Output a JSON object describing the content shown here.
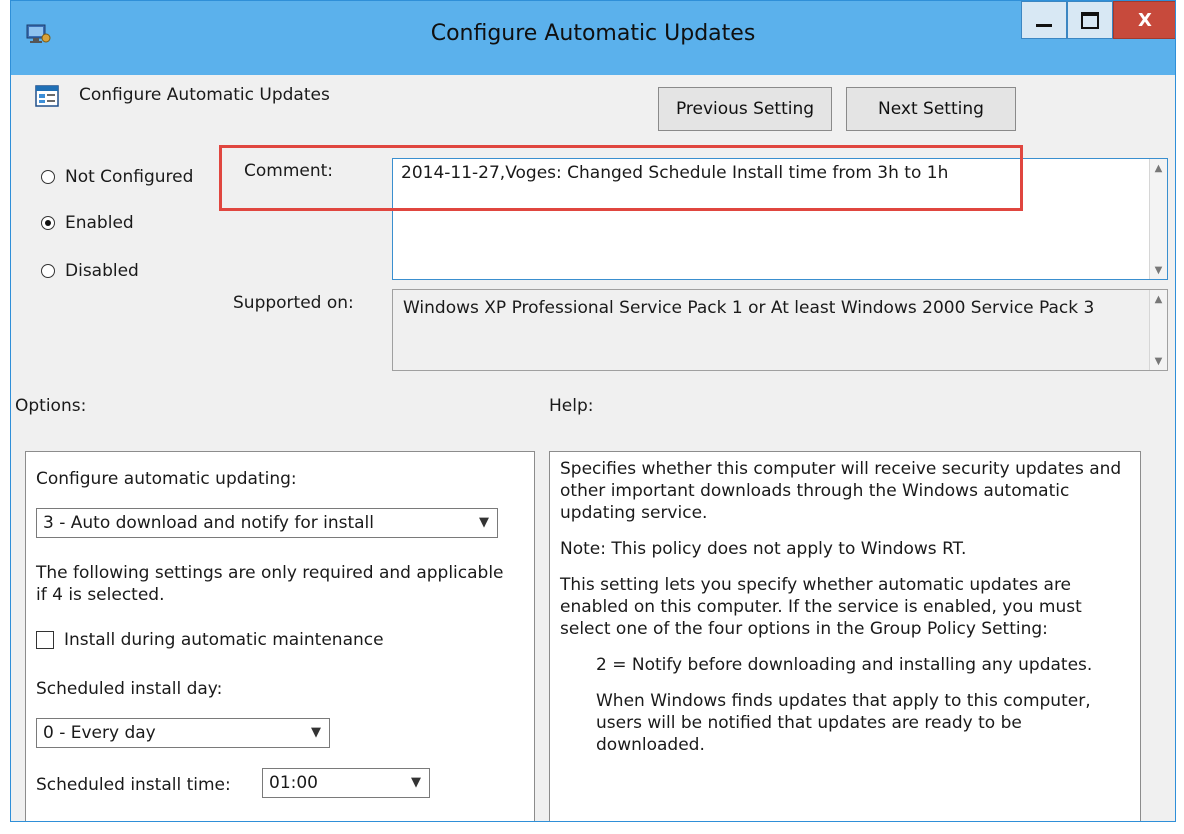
{
  "window": {
    "title": "Configure Automatic Updates",
    "controls": {
      "minimize": "minimize",
      "maximize": "maximize",
      "close": "X"
    }
  },
  "header": {
    "policy_name": "Configure Automatic Updates",
    "prev_button": "Previous Setting",
    "next_button": "Next Setting"
  },
  "state": {
    "options": [
      "Not Configured",
      "Enabled",
      "Disabled"
    ],
    "selected": "Enabled"
  },
  "comment": {
    "label": "Comment:",
    "value": "2014-11-27,Voges: Changed Schedule Install time from 3h to 1h"
  },
  "supported": {
    "label": "Supported on:",
    "value": "Windows XP Professional Service Pack 1 or At least Windows 2000 Service Pack 3"
  },
  "sections": {
    "options": "Options:",
    "help": "Help:"
  },
  "options": {
    "configure_label": "Configure automatic updating:",
    "configure_value": "3 - Auto download and notify for install",
    "note": "The following settings are only required and applicable if 4 is selected.",
    "maintenance_checkbox": "Install during automatic maintenance",
    "install_day_label": "Scheduled install day:",
    "install_day_value": "0 - Every day",
    "install_time_label": "Scheduled install time:",
    "install_time_value": "01:00"
  },
  "help": {
    "paragraphs": [
      "Specifies whether this computer will receive security updates and other important downloads through the Windows automatic updating service.",
      "Note: This policy does not apply to Windows RT.",
      "This setting lets you specify whether automatic updates are enabled on this computer. If the service is enabled, you must select one of the four options in the Group Policy Setting:",
      "2 = Notify before downloading and installing any updates.",
      "When Windows finds updates that apply to this computer, users will be notified that updates are ready to be downloaded."
    ]
  },
  "colors": {
    "titlebar": "#5bb1ec",
    "highlight": "#e0463f",
    "close_button": "#c74a3c"
  }
}
